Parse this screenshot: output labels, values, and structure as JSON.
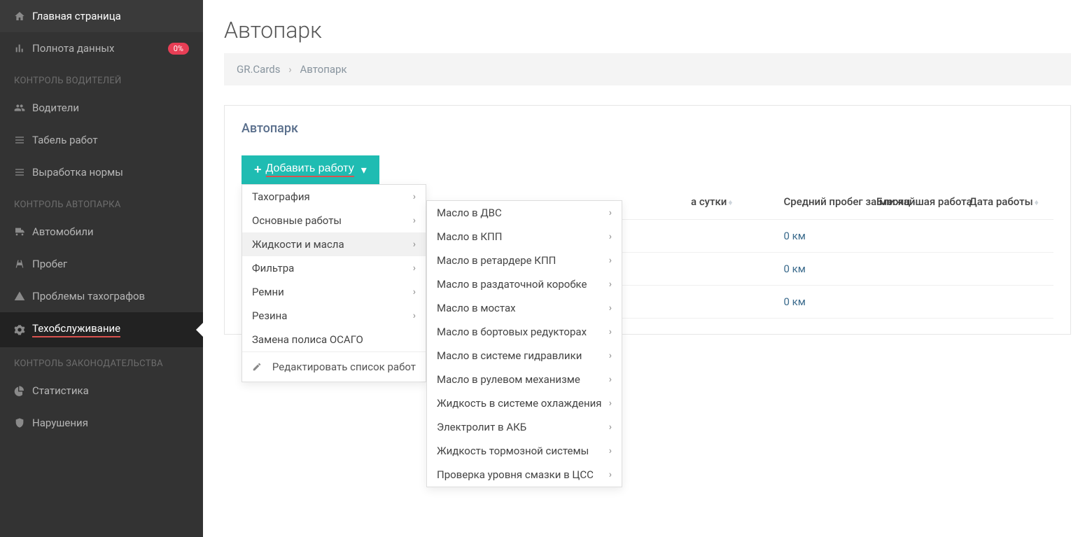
{
  "sidebar": {
    "nav": [
      {
        "label": "Главная страница",
        "icon": "home",
        "badge": null
      },
      {
        "label": "Полнота данных",
        "icon": "bars",
        "badge": "0%"
      }
    ],
    "sections": [
      {
        "title": "КОНТРОЛЬ ВОДИТЕЛЕЙ",
        "items": [
          {
            "label": "Водители",
            "icon": "users"
          },
          {
            "label": "Табель работ",
            "icon": "list"
          },
          {
            "label": "Выработка нормы",
            "icon": "list"
          }
        ]
      },
      {
        "title": "КОНТРОЛЬ АВТОПАРКА",
        "items": [
          {
            "label": "Автомобили",
            "icon": "truck"
          },
          {
            "label": "Пробег",
            "icon": "road"
          },
          {
            "label": "Проблемы тахографов",
            "icon": "warning"
          },
          {
            "label": "Техобслуживание",
            "icon": "gears",
            "active": true
          }
        ]
      },
      {
        "title": "КОНТРОЛЬ ЗАКОНОДАТЕЛЬСТВА",
        "items": [
          {
            "label": "Статистика",
            "icon": "pie"
          },
          {
            "label": "Нарушения",
            "icon": "shield"
          }
        ]
      }
    ]
  },
  "header": {
    "title": "Автопарк",
    "breadcrumb_root": "GR.Cards",
    "breadcrumb_current": "Автопарк"
  },
  "panel": {
    "title": "Автопарк",
    "add_button": "Добавить работу",
    "dropdown": [
      {
        "label": "Тахография",
        "children": true
      },
      {
        "label": "Основные работы",
        "children": true
      },
      {
        "label": "Жидкости и масла",
        "children": true,
        "hovered": true
      },
      {
        "label": "Фильтра",
        "children": true
      },
      {
        "label": "Ремни",
        "children": true
      },
      {
        "label": "Резина",
        "children": true
      },
      {
        "label": "Замена полиса ОСАГО",
        "children": false
      }
    ],
    "edit_list_label": "Редактировать список работ",
    "submenu": [
      "Масло в ДВС",
      "Масло в КПП",
      "Масло в ретардере КПП",
      "Масло в раздаточной коробке",
      "Масло в мостах",
      "Масло в бортовых редукторах",
      "Масло в системе гидравлики",
      "Масло в рулевом механизме",
      "Жидкость в системе охлаждения",
      "Электролит в АКБ",
      "Жидкость тормозной системы",
      "Проверка уровня смазки в ЦСС"
    ],
    "table": {
      "columns": [
        "а сутки",
        "Средний пробег за месяц",
        "Ближайшая работа",
        "Дата работы"
      ],
      "rows": [
        {
          "avg_month": "0 км"
        },
        {
          "avg_month": "0 км"
        },
        {
          "avg_month": "0 км"
        }
      ]
    }
  }
}
